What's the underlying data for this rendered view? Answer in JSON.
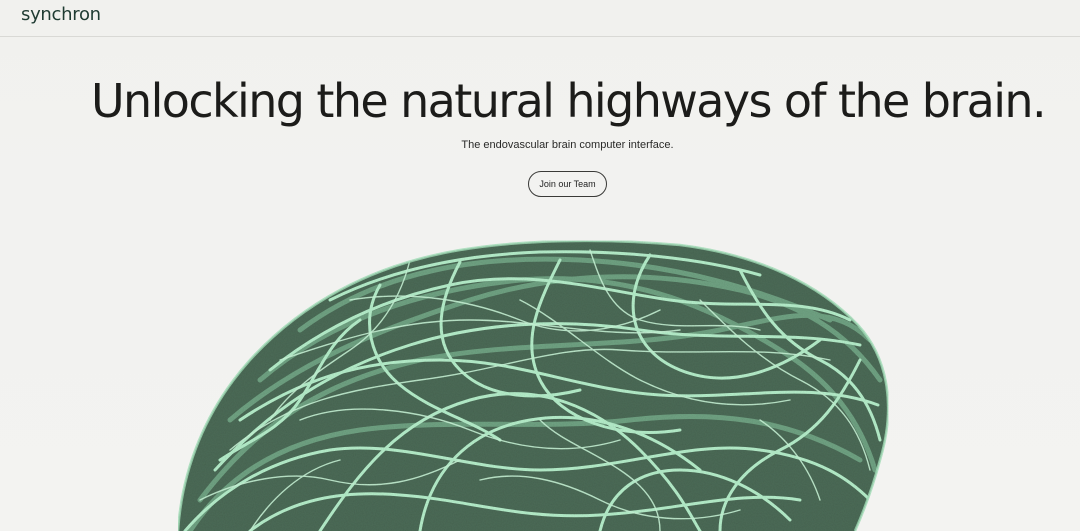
{
  "header": {
    "logo_text": "synchron"
  },
  "hero": {
    "title": "Unlocking the natural highways of the brain.",
    "subtitle": "The endovascular brain computer interface.",
    "cta_label": "Join our Team"
  },
  "illustration": {
    "icon": "brain-vessels-illustration",
    "colors": {
      "dark_fill": "#4a6a55",
      "vessel": "#b4ecc8",
      "vessel_dim": "#8fcfa6"
    }
  }
}
